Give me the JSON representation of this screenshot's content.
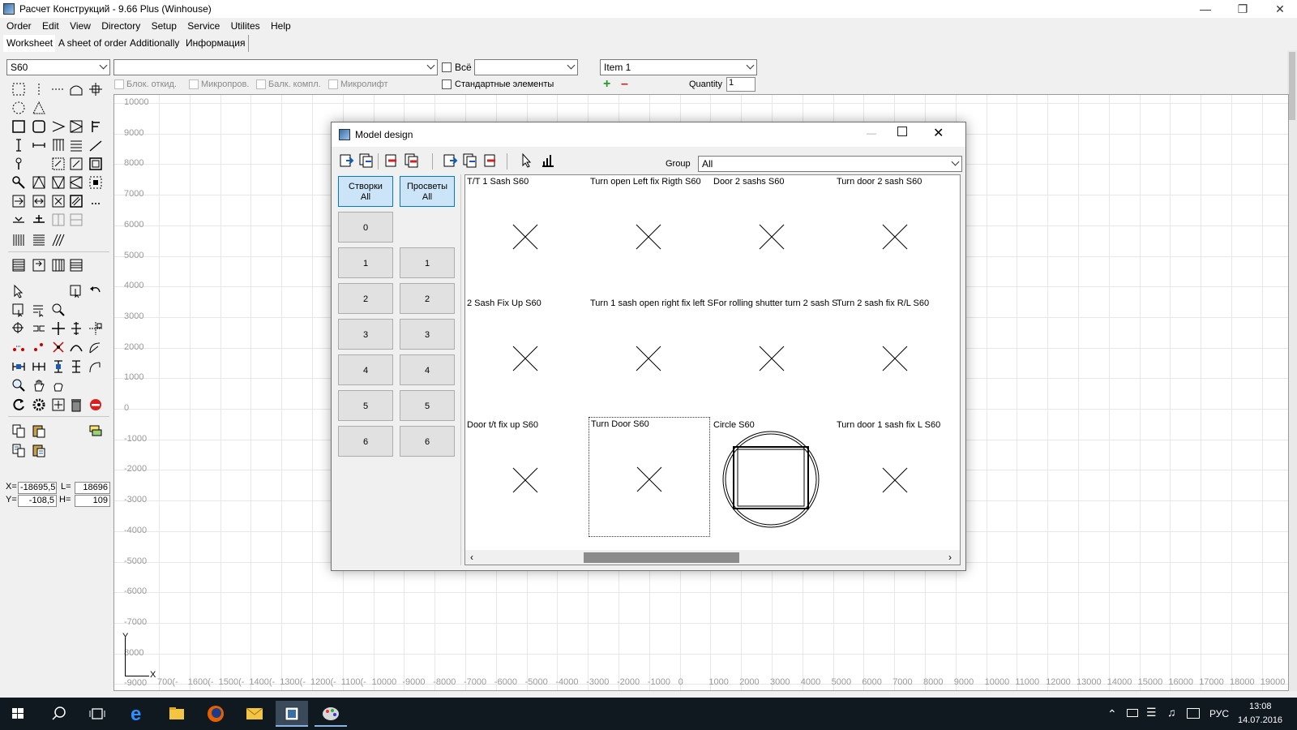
{
  "app": {
    "title": "Расчет Конструкций - 9.66 Plus (Winhouse)"
  },
  "menu": [
    "Order",
    "Edit",
    "View",
    "Directory",
    "Setup",
    "Service",
    "Utilites",
    "Help"
  ],
  "tabs": [
    "Worksheet",
    "A sheet of order",
    "Additionally",
    "Информация"
  ],
  "toolbar": {
    "profile_value": "S60",
    "product_value": "",
    "all_label": "Всё",
    "filter_value": "",
    "item_value": "Item 1",
    "quantity_label": "Quantity",
    "quantity_value": "1",
    "options": [
      "Блок. откид.",
      "Микропров.",
      "Балк. компл.",
      "Микролифт"
    ],
    "standard_label": "Стандартные элементы"
  },
  "coords": {
    "x_label": "X=",
    "x_value": "-18695,5",
    "l_label": "L=",
    "l_value": "18696",
    "y_label": "Y=",
    "y_value": "-108,5",
    "h_label": "H=",
    "h_value": "109"
  },
  "canvas": {
    "y_ticks": [
      "10000",
      "9000",
      "8000",
      "7000",
      "6000",
      "5000",
      "4000",
      "3000",
      "2000",
      "1000",
      "0",
      "-1000",
      "-2000",
      "-3000",
      "-4000",
      "-5000",
      "-6000",
      "-7000",
      "8000",
      "-9000"
    ],
    "x_ticks": [
      "700(-",
      "1600(-",
      "1500(-",
      "1400(-",
      "1300(-",
      "1200(-",
      "1100(-",
      "10000",
      "-9000",
      "-8000",
      "-7000",
      "-6000",
      "-5000",
      "-4000",
      "-3000",
      "-2000",
      "-1000",
      "0",
      "1000",
      "2000",
      "3000",
      "4000",
      "5000",
      "6000",
      "7000",
      "8000",
      "9000",
      "10000",
      "11000",
      "12000",
      "13000",
      "14000",
      "15000",
      "16000",
      "17000",
      "18000",
      "19000"
    ],
    "axis_x": "X",
    "axis_y": "Y"
  },
  "dialog": {
    "title": "Model design",
    "group_label": "Group",
    "group_value": "All",
    "left_col": {
      "header": [
        "Створки",
        "All"
      ],
      "buttons": [
        "0",
        "1",
        "2",
        "3",
        "4",
        "5",
        "6"
      ]
    },
    "right_col": {
      "header": [
        "Просветы",
        "All"
      ],
      "buttons": [
        "1",
        "2",
        "3",
        "4",
        "5",
        "6"
      ]
    },
    "models": [
      "T/T 1 Sash S60",
      "Turn open Left fix Rigth S60",
      "Door 2 sashs S60",
      "Turn door 2 sash S60",
      "2 Sash Fix Up S60",
      "Turn 1 sash open right fix left S",
      "For rolling shutter turn 2 sash S",
      "Turn 2 sash fix R/L S60",
      "Door t/t fix up S60",
      "Turn Door S60",
      "Circle S60",
      "Turn door 1 sash fix L S60"
    ]
  },
  "taskbar": {
    "lang": "РУС",
    "time": "13:08",
    "date": "14.07.2016"
  },
  "colors": {
    "accent": "#0078d7",
    "selected_btn": "#cce4f7",
    "taskbar": "#101820"
  }
}
